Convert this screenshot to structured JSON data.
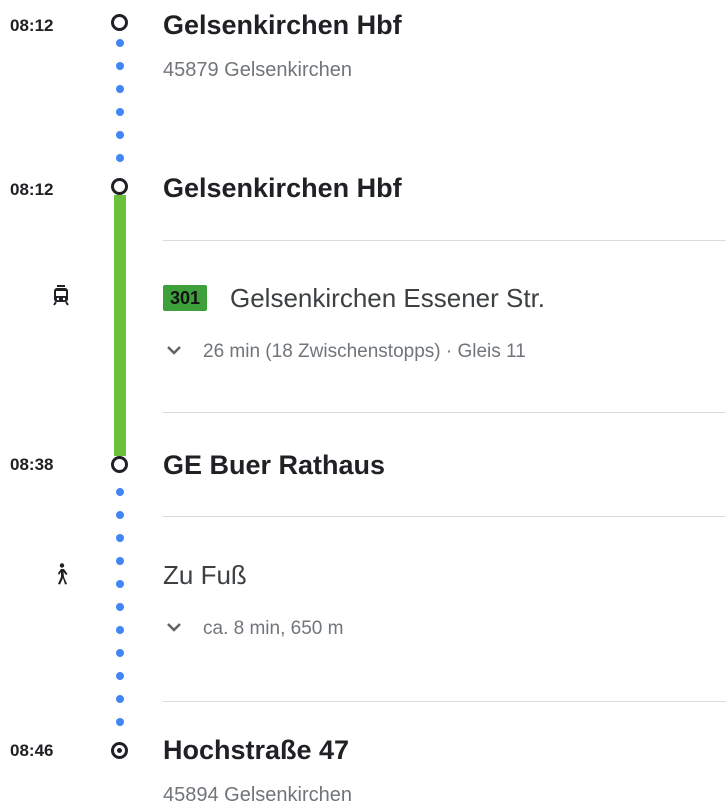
{
  "stops": [
    {
      "time": "08:12",
      "name": "Gelsenkirchen Hbf",
      "address": "45879 Gelsenkirchen"
    },
    {
      "time": "08:12",
      "name": "Gelsenkirchen Hbf"
    },
    {
      "time": "08:38",
      "name": "GE Buer Rathaus"
    },
    {
      "time": "08:46",
      "name": "Hochstraße 47",
      "address": "45894 Gelsenkirchen"
    }
  ],
  "transit_leg": {
    "line": "301",
    "direction": "Gelsenkirchen Essener Str.",
    "details": "26 min (18 Zwischenstopps) · Gleis 11",
    "mode_icon": "tram-icon",
    "line_color": "#6cc13c",
    "badge_color": "#3da03a"
  },
  "walk_leg": {
    "label": "Zu Fuß",
    "details": "ca. 8 min, 650 m",
    "mode_icon": "walking-icon",
    "dot_color": "#4285f4"
  }
}
